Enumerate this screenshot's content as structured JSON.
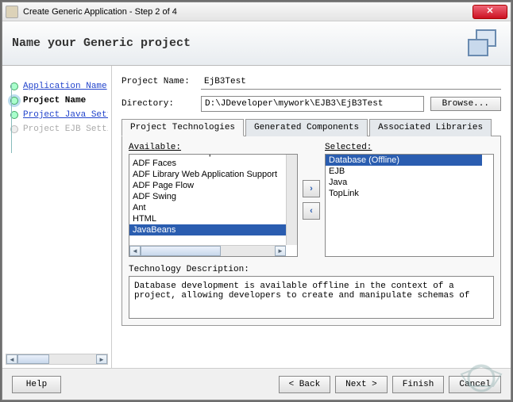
{
  "window": {
    "title": "Create Generic Application - Step 2 of 4"
  },
  "banner": {
    "title": "Name your Generic project"
  },
  "steps": [
    {
      "label": "Application Name",
      "state": "done"
    },
    {
      "label": "Project Name",
      "state": "current"
    },
    {
      "label": "Project Java Setting",
      "state": "done"
    },
    {
      "label": "Project EJB Setting",
      "state": "disabled"
    }
  ],
  "fields": {
    "project_name_label": "Project Name:",
    "project_name_value": "EjB3Test",
    "directory_label": "Directory:",
    "directory_value": "D:\\JDeveloper\\mywork\\EJB3\\EjB3Test",
    "browse_label": "Browse..."
  },
  "tabs": [
    {
      "label": "Project Technologies",
      "active": true
    },
    {
      "label": "Generated Components",
      "active": false
    },
    {
      "label": "Associated Libraries",
      "active": false
    }
  ],
  "available_label": "Available:",
  "selected_label": "Selected:",
  "available": [
    "ADF Business Components",
    "ADF Faces",
    "ADF Library Web Application Support",
    "ADF Page Flow",
    "ADF Swing",
    "Ant",
    "HTML",
    "JavaBeans"
  ],
  "available_selected_index": 7,
  "selected": [
    "Database (Offline)",
    "EJB",
    "Java",
    "TopLink"
  ],
  "selected_selected_index": 0,
  "desc_label": "Technology Description:",
  "desc_text": "Database development is available offline in the context of a project, allowing developers to create and manipulate schemas of",
  "footer": {
    "help": "Help",
    "back": "< Back",
    "next": "Next >",
    "finish": "Finish",
    "cancel": "Cancel"
  }
}
